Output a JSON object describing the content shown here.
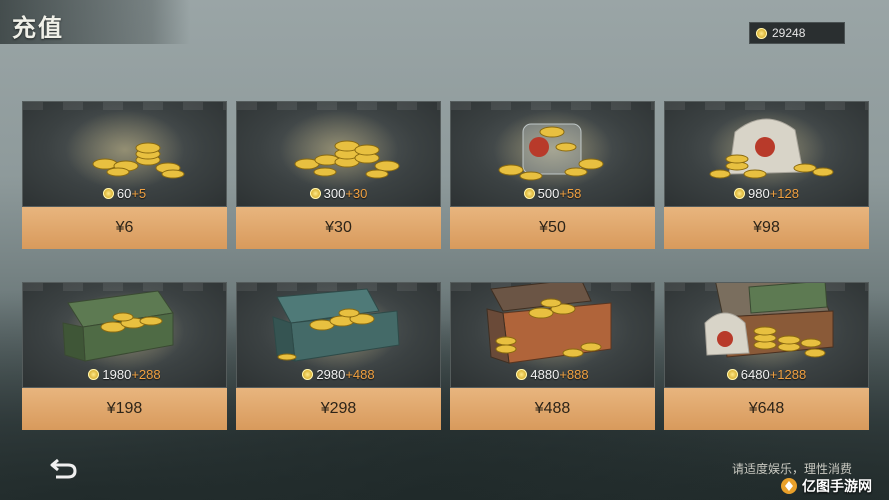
{
  "header": {
    "title": "充值"
  },
  "balance": {
    "value": "29248",
    "icon": "gold-coin-icon"
  },
  "colors": {
    "bonus": "#f0a040",
    "price_bar": "#e0a86a",
    "card_bg": "#3b4142"
  },
  "packages": [
    {
      "amount": "60",
      "bonus": "+5",
      "price": "¥6",
      "art": "coin-pile-small"
    },
    {
      "amount": "300",
      "bonus": "+30",
      "price": "¥30",
      "art": "coin-pile"
    },
    {
      "amount": "500",
      "bonus": "+58",
      "price": "¥50",
      "art": "coin-jar"
    },
    {
      "amount": "980",
      "bonus": "+128",
      "price": "¥98",
      "art": "coin-sack"
    },
    {
      "amount": "1980",
      "bonus": "+288",
      "price": "¥198",
      "art": "green-ammo-box"
    },
    {
      "amount": "2980",
      "bonus": "+488",
      "price": "¥298",
      "art": "teal-ammo-box"
    },
    {
      "amount": "4880",
      "bonus": "+888",
      "price": "¥488",
      "art": "wooden-crate"
    },
    {
      "amount": "6480",
      "bonus": "+1288",
      "price": "¥648",
      "art": "crate-stack"
    }
  ],
  "footer": {
    "note": "请适度娱乐，理性消费",
    "back_icon": "back-arrow-icon"
  },
  "watermark": {
    "text": "亿图手游网"
  }
}
